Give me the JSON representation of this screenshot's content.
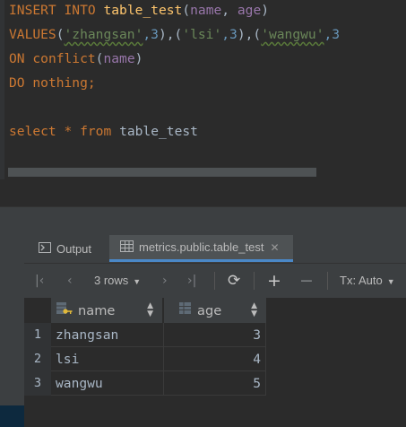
{
  "editor": {
    "line1": {
      "insert": "INSERT",
      "into": "INTO",
      "table": "table_test",
      "open": "(",
      "col1": "name",
      "comma": ", ",
      "col2": "age",
      "close": ")"
    },
    "line2": {
      "values": "VALUES",
      "open1": "(",
      "v1": "'zhangsan'",
      "n1": ",3",
      "sep1": "),(",
      "v2": "'lsi'",
      "n2": ",3",
      "sep2": "),(",
      "v3": "'wangwu'",
      "n3": ",3"
    },
    "line3": {
      "on": "ON",
      "conflict": "conflict",
      "open": "(",
      "col": "name",
      "close": ")"
    },
    "line4": {
      "do": "DO",
      "nothing": "nothing",
      "semi": ";"
    },
    "line6": {
      "select": "select",
      "star": "*",
      "from": "from",
      "table": "table_test"
    }
  },
  "tabs": {
    "output_label": "Output",
    "table_label": "metrics.public.table_test",
    "close_glyph": "✕"
  },
  "toolbar": {
    "rows_label": "3 rows",
    "tx_label": "Tx: Auto"
  },
  "grid": {
    "columns": [
      "name",
      "age"
    ],
    "rows": [
      {
        "num": "1",
        "name": "zhangsan",
        "age": "3"
      },
      {
        "num": "2",
        "name": "lsi",
        "age": "4"
      },
      {
        "num": "3",
        "name": "wangwu",
        "age": "5"
      }
    ]
  },
  "icons": [
    "output-icon",
    "table-icon",
    "first-page-icon",
    "prev-page-icon",
    "next-page-icon",
    "last-page-icon",
    "refresh-icon",
    "add-row-icon",
    "remove-row-icon",
    "column-key-icon",
    "column-icon",
    "sort-icon"
  ],
  "colors": {
    "keyword": "#cc7832",
    "string": "#6a8759",
    "number": "#6897bb",
    "identifier": "#9876aa",
    "function": "#ffc66d",
    "selection": "#0d293e",
    "tab_underline": "#4a88c7"
  }
}
